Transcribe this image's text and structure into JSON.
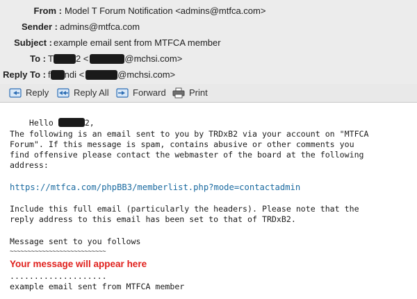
{
  "headers": {
    "from": {
      "label": "From :",
      "value": "Model T Forum Notification <admins@mtfca.com>"
    },
    "sender": {
      "label": "Sender :",
      "value": "admins@mtfca.com"
    },
    "subject": {
      "label": "Subject :",
      "value": "example email sent from MTFCA member"
    },
    "to": {
      "label": "To :",
      "prefix": "T",
      "name_end": "2",
      "open": " <",
      "domain": "@mchsi.com>"
    },
    "reply_to": {
      "label": "Reply To :",
      "prefix": "f",
      "name_end": "ndi",
      "open": " <",
      "domain": "@mchsi.com>"
    }
  },
  "toolbar": {
    "reply_label": "Reply",
    "reply_all_label": "Reply All",
    "forward_label": "Forward",
    "print_label": "Print"
  },
  "body": {
    "greeting_start": "Hello ",
    "greeting_end": "2,",
    "para1": [
      "The following is an email sent to you by TRDxB2 via your account on \"MTFCA",
      "Forum\". If this message is spam, contains abusive or other comments you",
      "find offensive please contact the webmaster of the board at the following",
      "address:"
    ],
    "link": "https://mtfca.com/phpBB3/memberlist.php?mode=contactadmin",
    "para2": [
      "Include this full email (particularly the headers). Please note that the",
      "reply address to this email has been set to that of TRDxB2."
    ],
    "follows": "Message sent to you follows",
    "tilde_rule": "~~~~~~~~~~~~~~~~~~~~~~~~~~~",
    "red_note": "Your message will appear here",
    "dot_rule": "....................",
    "final": "example email sent from MTFCA member"
  },
  "colors": {
    "header_bg": "#ececec",
    "link": "#1a6aa0",
    "note_red": "#e0201c",
    "icon_blue": "#2f6fb5"
  }
}
